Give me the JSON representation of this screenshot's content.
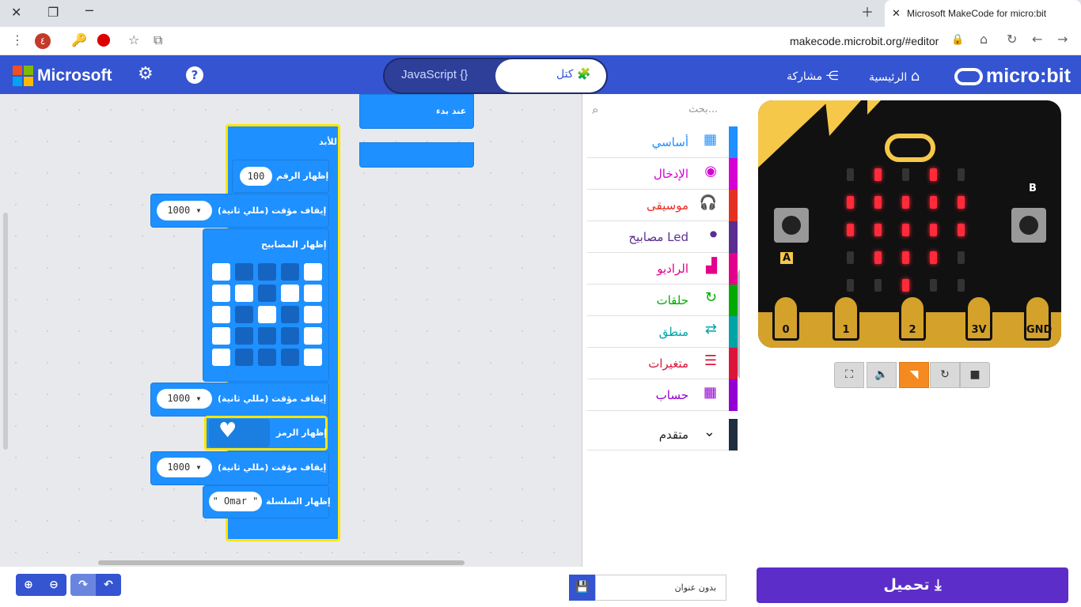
{
  "browser": {
    "tab_title": "Microsoft MakeCode for micro:bit",
    "url": "makecode.microbit.org/#editor",
    "extension_count": "٤"
  },
  "header": {
    "brand": "Microsoft",
    "javascript_label": "JavaScript",
    "blocks_label": "كتل",
    "home_label": "الرئيسية",
    "share_label": "مشاركة",
    "microbit_logo": "micro:bit"
  },
  "toolbox": {
    "search_placeholder": "بحث...",
    "categories": [
      {
        "label": "أساسي",
        "icon": "grid-icon",
        "color": "#1e90ff"
      },
      {
        "label": "الإدخال",
        "icon": "input-icon",
        "color": "#d400d4"
      },
      {
        "label": "موسيقى",
        "icon": "headphones-icon",
        "color": "#e63022"
      },
      {
        "label": "مصابيح Led",
        "icon": "toggle-icon",
        "color": "#5c2d91"
      },
      {
        "label": "الراديو",
        "icon": "signal-icon",
        "color": "#e3008c"
      },
      {
        "label": "حلقات",
        "icon": "loop-icon",
        "color": "#00aa00"
      },
      {
        "label": "منطق",
        "icon": "shuffle-icon",
        "color": "#00a4a6"
      },
      {
        "label": "متغيرات",
        "icon": "list-icon",
        "color": "#dc143c"
      },
      {
        "label": "حساب",
        "icon": "calculator-icon",
        "color": "#9400d3"
      }
    ],
    "advanced_label": "متقدم"
  },
  "blocks": {
    "on_start": "عند بدء",
    "forever": "للأبد",
    "show_number_label": "إظهار الرقم",
    "show_number_value": "100",
    "pause_label": "إيقاف مؤقت (مللي ثانية)",
    "pause_value": "1000 ▾",
    "show_leds_label": "إظهار المصابيح",
    "show_icon_label": "إظهار الرمز",
    "show_string_label": "إظهار السلسلة",
    "show_string_value": "\" Omar \"",
    "led_grid": [
      [
        1,
        0,
        0,
        0,
        1
      ],
      [
        1,
        1,
        0,
        1,
        1
      ],
      [
        1,
        0,
        1,
        0,
        1
      ],
      [
        1,
        0,
        0,
        0,
        1
      ],
      [
        1,
        0,
        0,
        0,
        1
      ]
    ]
  },
  "simulator": {
    "pins": [
      "0",
      "1",
      "2",
      "3V",
      "GND"
    ],
    "button_a": "A",
    "button_b": "B",
    "leds_on": [
      [
        0,
        1,
        0,
        1,
        0
      ],
      [
        1,
        1,
        1,
        1,
        1
      ],
      [
        1,
        1,
        1,
        1,
        1
      ],
      [
        0,
        1,
        1,
        1,
        0
      ],
      [
        0,
        0,
        1,
        0,
        0
      ]
    ],
    "led_color": "#ff2a3a"
  },
  "bottom": {
    "download_label": "تحميل",
    "project_name": "بدون عنوان"
  }
}
